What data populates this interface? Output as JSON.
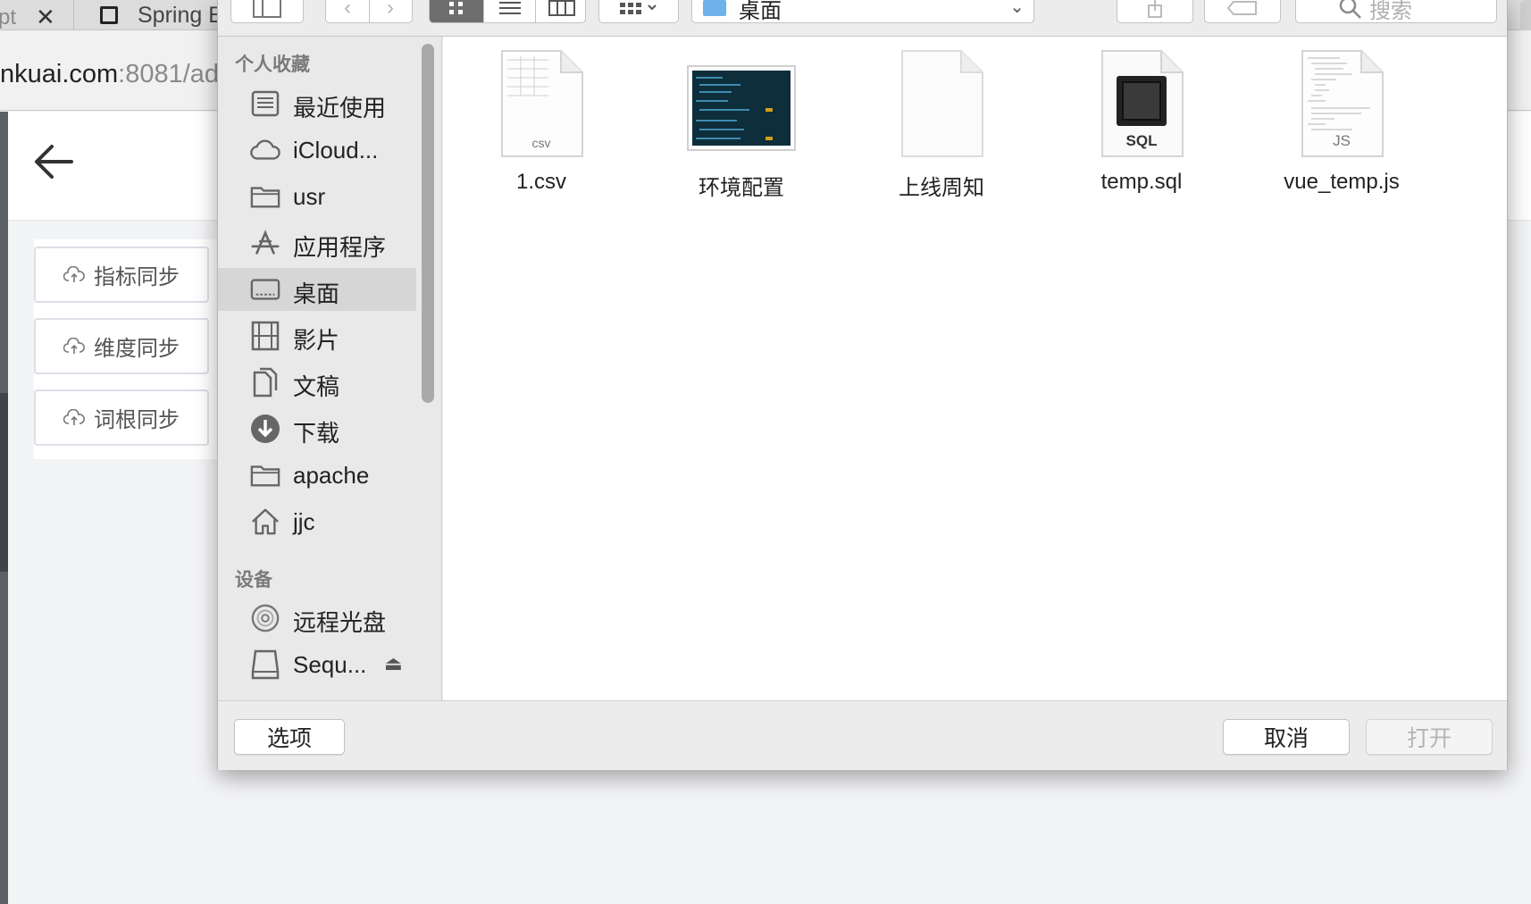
{
  "browser": {
    "tab_fragment": "pt",
    "close_glyph": "✕",
    "tab_title": "Spring E",
    "url_host": "nkuai.com",
    "url_port_path": ":8081/ad"
  },
  "page": {
    "sync_buttons": [
      {
        "label": "指标同步",
        "icon": "cloud-upload-icon"
      },
      {
        "label": "维度同步",
        "icon": "cloud-upload-icon"
      },
      {
        "label": "词根同步",
        "icon": "cloud-upload-icon"
      }
    ]
  },
  "dialog": {
    "location": "桌面",
    "search_placeholder": "搜索",
    "sidebar": {
      "favorites_title": "个人收藏",
      "devices_title": "设备",
      "favorites": [
        {
          "label": "最近使用",
          "icon": "recents-icon"
        },
        {
          "label": "iCloud...",
          "icon": "cloud-icon"
        },
        {
          "label": "usr",
          "icon": "folder-icon"
        },
        {
          "label": "应用程序",
          "icon": "applications-icon"
        },
        {
          "label": "桌面",
          "icon": "desktop-icon",
          "selected": true
        },
        {
          "label": "影片",
          "icon": "film-icon"
        },
        {
          "label": "文稿",
          "icon": "documents-icon"
        },
        {
          "label": "下载",
          "icon": "download-icon"
        },
        {
          "label": "apache",
          "icon": "folder-icon"
        },
        {
          "label": "jjc",
          "icon": "home-icon"
        }
      ],
      "devices": [
        {
          "label": "远程光盘",
          "icon": "disc-icon"
        },
        {
          "label": "Sequ...",
          "icon": "drive-icon",
          "eject": "⏏"
        }
      ]
    },
    "files": [
      {
        "name": "1.csv",
        "icon": "csv-file-icon",
        "badge": "csv"
      },
      {
        "name": "环境配置",
        "icon": "screenshot-thumbnail-icon"
      },
      {
        "name": "上线周知",
        "icon": "blank-document-icon"
      },
      {
        "name": "temp.sql",
        "icon": "sql-file-icon",
        "badge": "SQL"
      },
      {
        "name": "vue_temp.js",
        "icon": "js-file-icon",
        "badge": "JS"
      }
    ],
    "footer": {
      "options_label": "选项",
      "cancel_label": "取消",
      "open_label": "打开"
    }
  }
}
